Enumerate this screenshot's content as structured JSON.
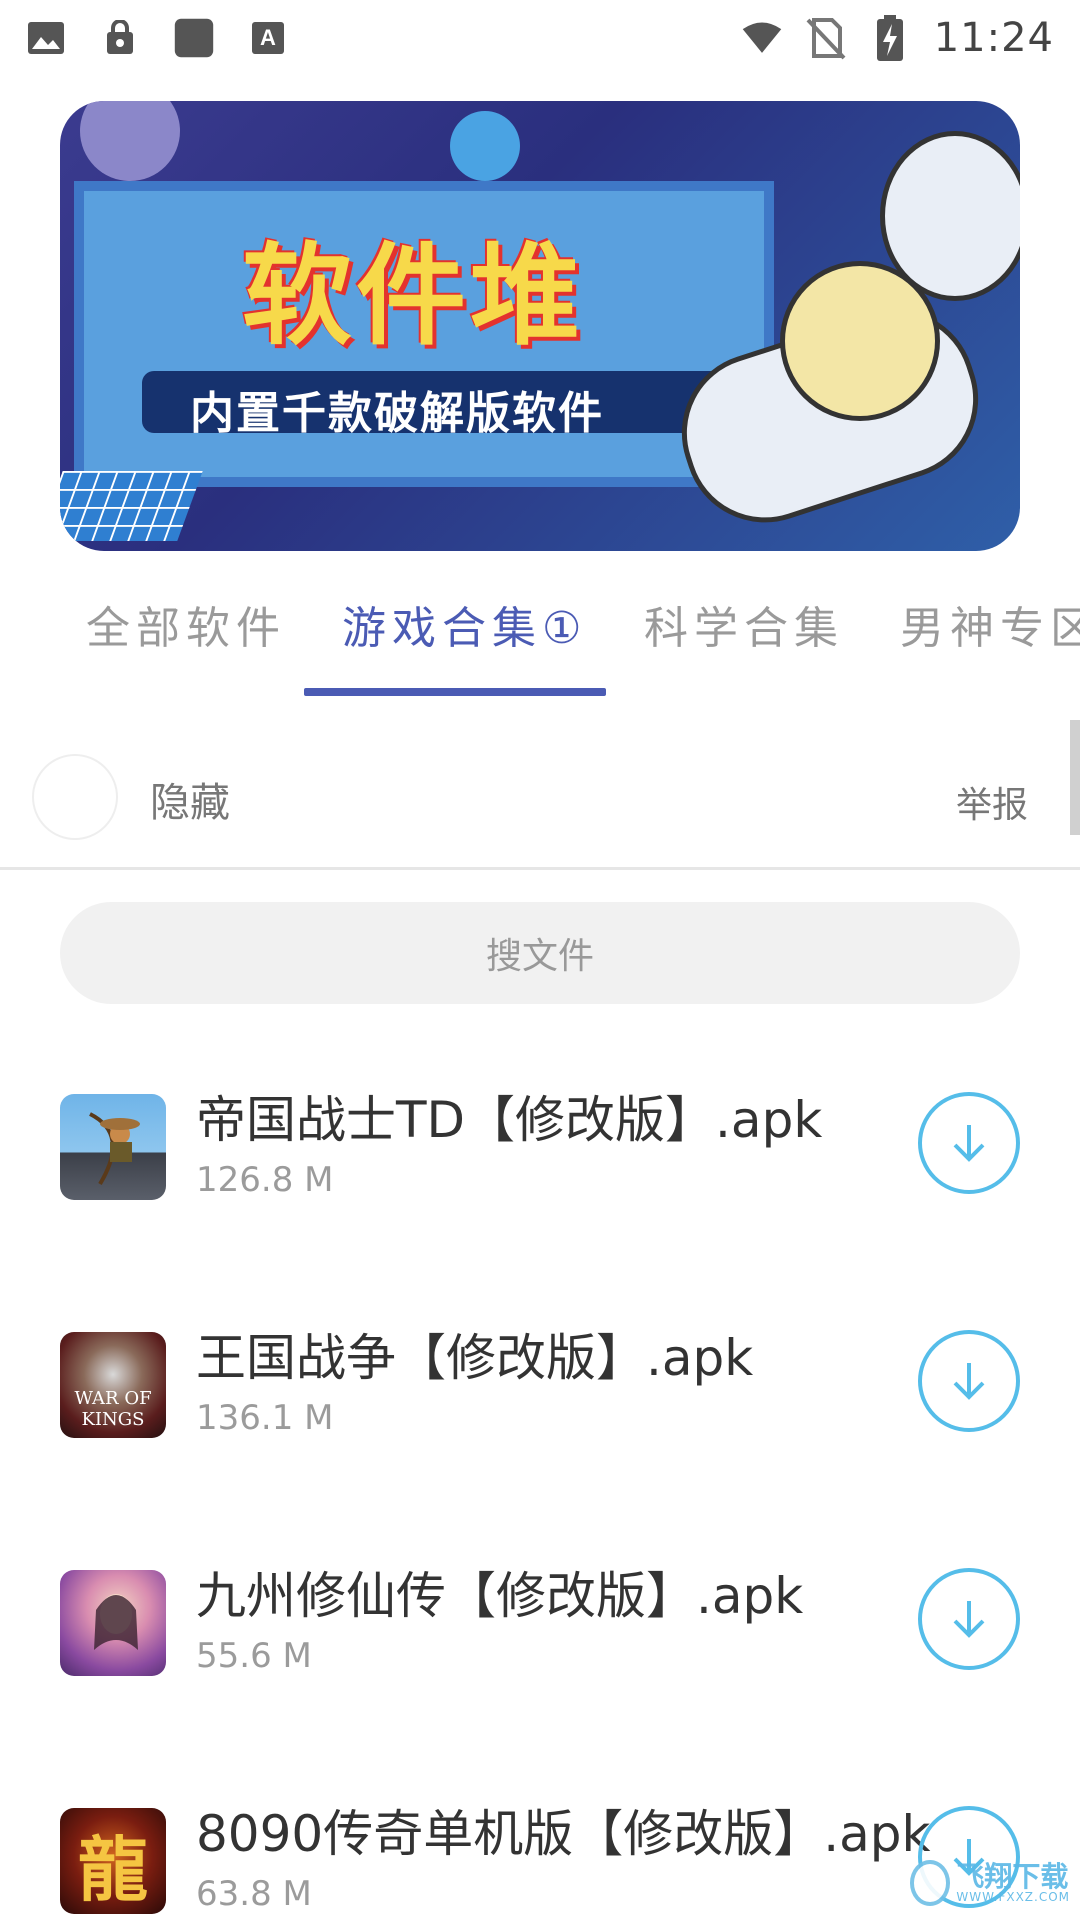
{
  "status_bar": {
    "time": "11:24",
    "left_icons": [
      "image-icon",
      "lock-bag-icon",
      "app-square-icon",
      "font-a-icon"
    ],
    "right_icons": [
      "wifi-icon",
      "no-sim-icon",
      "battery-charging-icon"
    ]
  },
  "banner": {
    "title": "软件堆",
    "subtitle": "内置千款破解版软件"
  },
  "tabs": [
    {
      "label": "全部软件",
      "active": false
    },
    {
      "label": "游戏合集①",
      "active": true
    },
    {
      "label": "科学合集",
      "active": false
    },
    {
      "label": "男神专区",
      "active": false
    }
  ],
  "ad": {
    "hide_label": "隐藏",
    "report_label": "举报"
  },
  "search": {
    "placeholder": "搜文件"
  },
  "files": [
    {
      "name": "帝国战士TD【修改版】.apk",
      "size": "126.8 M",
      "icon": "archer-game-icon"
    },
    {
      "name": "王国战争【修改版】.apk",
      "size": "136.1 M",
      "icon": "war-of-kings-icon",
      "icon_text": "WAR OF KINGS"
    },
    {
      "name": "九州修仙传【修改版】.apk",
      "size": "55.6 M",
      "icon": "xianxia-girl-icon"
    },
    {
      "name": "8090传奇单机版【修改版】.apk",
      "size": "63.8 M",
      "icon": "dragon-icon",
      "icon_text": "龍"
    }
  ],
  "watermark": {
    "cn": "飞翔下载",
    "en": "WWW.FXXZ.COM"
  },
  "colors": {
    "accent": "#4b5bb4",
    "download": "#55bde9",
    "muted_text": "#9b9b9b"
  }
}
